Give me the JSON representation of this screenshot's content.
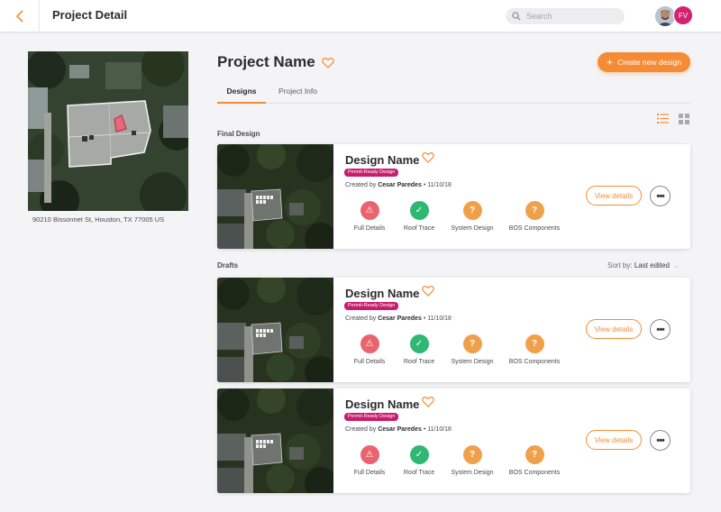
{
  "header": {
    "title": "Project Detail",
    "search_placeholder": "Search",
    "user_initials": "FV"
  },
  "project": {
    "name": "Project Name",
    "address": "90210 Bissonnet St, Houston, TX 77005 US",
    "create_button": "Create new design"
  },
  "tabs": [
    {
      "label": "Designs",
      "active": true
    },
    {
      "label": "Project Info",
      "active": false
    }
  ],
  "sections": {
    "final": "Final Design",
    "drafts": "Drafts",
    "sort_label": "Sort by:",
    "sort_value": "Last edited"
  },
  "cards": [
    {
      "name": "Design Name",
      "badge": "Permit-Ready Design",
      "created_prefix": "Created by",
      "author": "Cesar Paredes",
      "date": "• 11/10/18",
      "view_label": "View details",
      "statuses": [
        {
          "label": "Full Details",
          "state": "warning",
          "glyph": "⚠"
        },
        {
          "label": "Roof Trace",
          "state": "ok",
          "glyph": "✓"
        },
        {
          "label": "System Design",
          "state": "unknown",
          "glyph": "?"
        },
        {
          "label": "BOS Components",
          "state": "unknown",
          "glyph": "?"
        }
      ]
    },
    {
      "name": "Design Name",
      "badge": "Permit-Ready Design",
      "created_prefix": "Created by",
      "author": "Cesar Paredes",
      "date": "• 11/10/18",
      "view_label": "View details",
      "statuses": [
        {
          "label": "Full Details",
          "state": "warning",
          "glyph": "⚠"
        },
        {
          "label": "Roof Trace",
          "state": "ok",
          "glyph": "✓"
        },
        {
          "label": "System Design",
          "state": "unknown",
          "glyph": "?"
        },
        {
          "label": "BOS Components",
          "state": "unknown",
          "glyph": "?"
        }
      ]
    },
    {
      "name": "Design Name",
      "badge": "Permit-Ready Design",
      "created_prefix": "Created by",
      "author": "Cesar Paredes",
      "date": "• 11/10/18",
      "view_label": "View details",
      "statuses": [
        {
          "label": "Full Details",
          "state": "warning",
          "glyph": "⚠"
        },
        {
          "label": "Roof Trace",
          "state": "ok",
          "glyph": "✓"
        },
        {
          "label": "System Design",
          "state": "unknown",
          "glyph": "?"
        },
        {
          "label": "BOS Components",
          "state": "unknown",
          "glyph": "?"
        }
      ]
    }
  ],
  "colors": {
    "accent": "#f58c35",
    "badge": "#c81d6f",
    "avatar": "#d3206f",
    "warning": "#e9646e",
    "ok": "#2eb872",
    "unknown": "#f0a04b"
  }
}
